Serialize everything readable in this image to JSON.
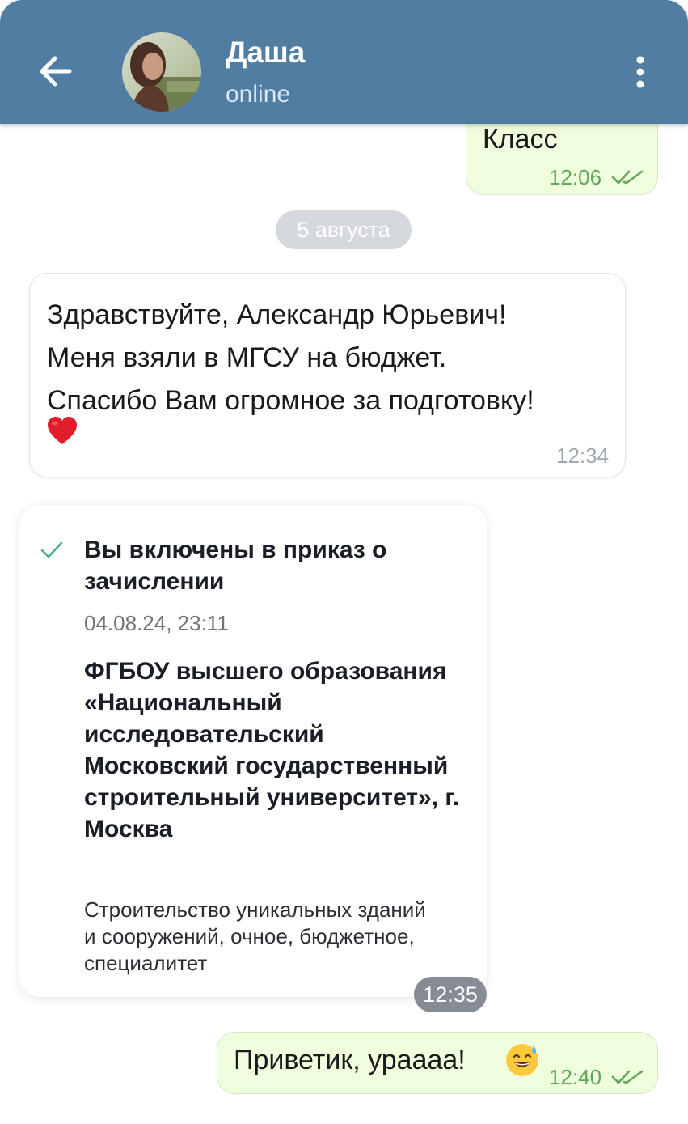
{
  "header": {
    "contact_name": "Даша",
    "status": "online",
    "back_icon": "arrow-left-icon",
    "menu_icon": "more-vert-icon",
    "background_color": "#527da3"
  },
  "messages": [
    {
      "direction": "out",
      "text": "Класс",
      "time": "12:06",
      "read": true
    },
    {
      "type": "date_separator",
      "text": "5 августа"
    },
    {
      "direction": "in",
      "text_lines": [
        "Здравствуйте, Александр Юрьевич!",
        "Меня взяли в МГСУ на бюджет.",
        "Спасибо Вам огромное за подготовку!"
      ],
      "emoji": "❤️",
      "time": "12:34"
    },
    {
      "direction": "in",
      "type": "forwarded_card",
      "title": "Вы включены в приказ о зачислении",
      "date": "04.08.24, 23:11",
      "organization": "ФГБОУ высшего образования «Национальный исследовательский Московский государственный строительный университет», г. Москва",
      "program": "Строительство уникальных зданий и сооружений, очное, бюджетное, специалитет",
      "time": "12:35"
    },
    {
      "direction": "out",
      "text": "Приветик, урааaa!",
      "emoji": "😅",
      "time": "12:40",
      "read": true
    }
  ]
}
